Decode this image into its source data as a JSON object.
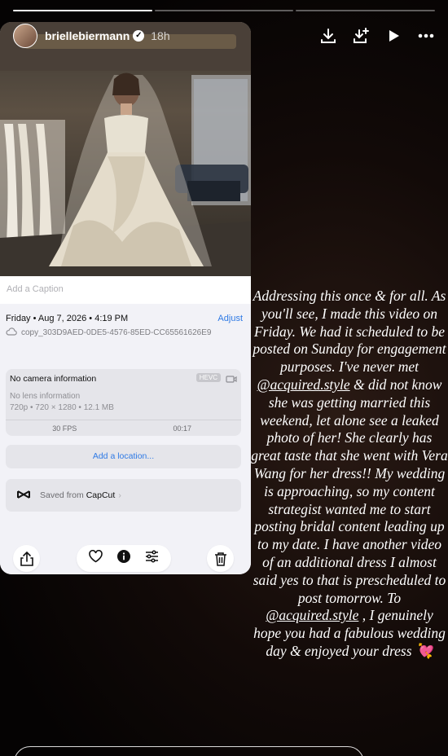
{
  "story": {
    "username": "briellebiermann",
    "time_ago": "18h",
    "segments": [
      "done",
      "active",
      "pending"
    ]
  },
  "screenshot": {
    "caption_placeholder": "Add a Caption",
    "date": "Friday • Aug 7, 2026 • 4:19 PM",
    "adjust_label": "Adjust",
    "filename": "copy_303D9AED-0DE5-4576-85ED-CC65561626E9",
    "camera_info": "No camera information",
    "codec_badge": "HEVC",
    "lens_info": "No lens information",
    "specs": "720p • 720 × 1280 • 12.1 MB",
    "fps": "30 FPS",
    "duration": "00:17",
    "add_location": "Add a location...",
    "saved_from_prefix": "Saved from",
    "saved_from_app": "CapCut"
  },
  "text": {
    "p1": "Addressing this once & for all. As you'll see, I made this video on Friday. We had it scheduled to be posted on Sunday for engagement purposes. I've never met",
    "mention1": "@acquired.style",
    "p2": "& did not know she was getting married this weekend, let alone see a leaked photo of her! She clearly has great taste that she went with Vera Wang for her dress!! My wedding is approaching, so my content strategist wanted me to start posting bridal content leading up to my date. I have another video of an additional dress I almost said yes to that is prescheduled to post tomorrow. To",
    "mention2": "@acquired.style",
    "p3": ", I genuinely hope you had a fabulous wedding day & enjoyed your dress",
    "emoji": "💘"
  },
  "colors": {
    "link_blue": "#2f7ae5",
    "card_bg": "#f2f2f7"
  },
  "icons": [
    "download-icon",
    "add-to-story-icon",
    "play-icon",
    "more-icon",
    "share-icon",
    "heart-icon",
    "info-icon",
    "adjust-sliders-icon",
    "trash-icon",
    "capcut-icon",
    "camera-icon",
    "cloud-icon"
  ]
}
